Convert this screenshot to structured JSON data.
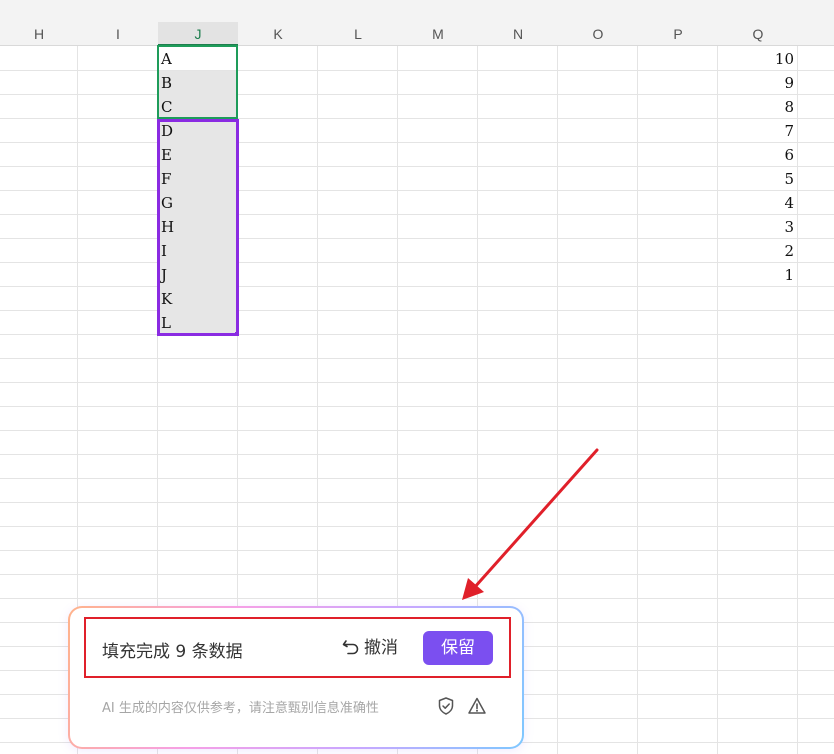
{
  "columns": [
    "H",
    "I",
    "J",
    "K",
    "L",
    "M",
    "N",
    "O",
    "P",
    "Q"
  ],
  "active_column": "J",
  "column_j": {
    "original": [
      "A",
      "B",
      "C"
    ],
    "filled": [
      "D",
      "E",
      "F",
      "G",
      "H",
      "I",
      "J",
      "K",
      "L"
    ]
  },
  "column_q": [
    "10",
    "9",
    "8",
    "7",
    "6",
    "5",
    "4",
    "3",
    "2",
    "1"
  ],
  "ai_panel": {
    "status": "填充完成 9 条数据",
    "undo_label": "撤消",
    "keep_label": "保留",
    "disclaimer": "AI 生成的内容仅供参考，请注意甄别信息准确性",
    "icons": [
      "undo-icon",
      "shield-check-icon",
      "warning-icon"
    ]
  },
  "colors": {
    "original_selection": "#1e9c5a",
    "fill_selection": "#8a2be2",
    "keep_button": "#7b4ff0",
    "annotation": "#e0202a"
  }
}
